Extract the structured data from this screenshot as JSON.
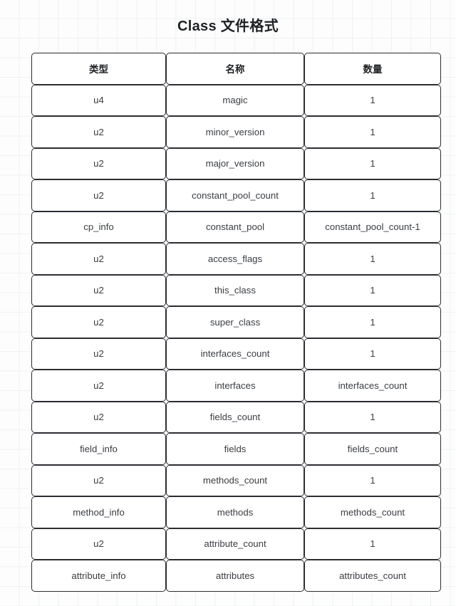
{
  "title": "Class 文件格式",
  "table": {
    "columns": [
      "类型",
      "名称",
      "数量"
    ],
    "rows": [
      {
        "type": "u4",
        "name": "magic",
        "count": "1"
      },
      {
        "type": "u2",
        "name": "minor_version",
        "count": "1"
      },
      {
        "type": "u2",
        "name": "major_version",
        "count": "1"
      },
      {
        "type": "u2",
        "name": "constant_pool_count",
        "count": "1"
      },
      {
        "type": "cp_info",
        "name": "constant_pool",
        "count": "constant_pool_count-1"
      },
      {
        "type": "u2",
        "name": "access_flags",
        "count": "1"
      },
      {
        "type": "u2",
        "name": "this_class",
        "count": "1"
      },
      {
        "type": "u2",
        "name": "super_class",
        "count": "1"
      },
      {
        "type": "u2",
        "name": "interfaces_count",
        "count": "1"
      },
      {
        "type": "u2",
        "name": "interfaces",
        "count": "interfaces_count"
      },
      {
        "type": "u2",
        "name": "fields_count",
        "count": "1"
      },
      {
        "type": "field_info",
        "name": "fields",
        "count": "fields_count"
      },
      {
        "type": "u2",
        "name": "methods_count",
        "count": "1"
      },
      {
        "type": "method_info",
        "name": "methods",
        "count": "methods_count"
      },
      {
        "type": "u2",
        "name": "attribute_count",
        "count": "1"
      },
      {
        "type": "attribute_info",
        "name": "attributes",
        "count": "attributes_count"
      }
    ]
  },
  "colors": {
    "border": "#2b2d31",
    "text": "#3a3d42",
    "title": "#1f2124",
    "cell_background": "#ffffff",
    "page_background": "#fdfdfd",
    "grid_line": "#cdd4de"
  }
}
